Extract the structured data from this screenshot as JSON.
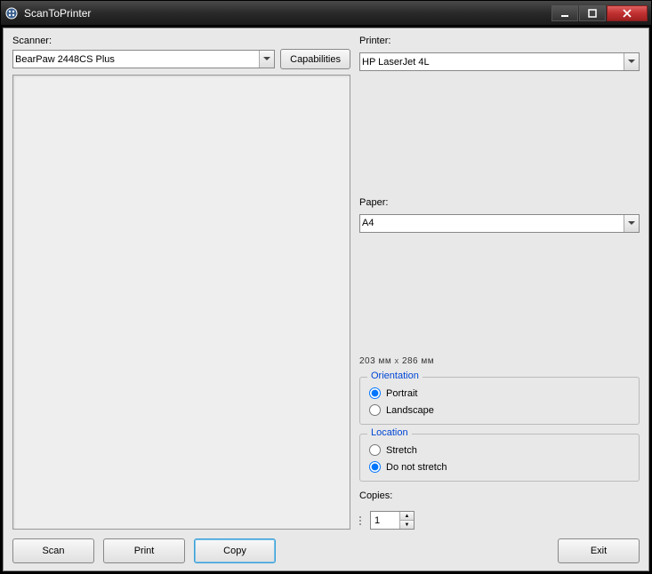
{
  "window": {
    "title": "ScanToPrinter"
  },
  "scanner": {
    "label": "Scanner:",
    "selected": "BearPaw 2448CS Plus",
    "capabilities_label": "Capabilities"
  },
  "printer": {
    "label": "Printer:",
    "selected": "HP LaserJet 4L"
  },
  "paper": {
    "label": "Paper:",
    "selected": "A4",
    "dimensions": "203 ᴍᴍ x 286 ᴍᴍ"
  },
  "orientation": {
    "group_label": "Orientation",
    "options": {
      "portrait": "Portrait",
      "landscape": "Landscape"
    },
    "selected": "portrait"
  },
  "location": {
    "group_label": "Location",
    "options": {
      "stretch": "Stretch",
      "nostretch": "Do not stretch"
    },
    "selected": "nostretch"
  },
  "copies": {
    "label": "Copies:",
    "value": "1"
  },
  "buttons": {
    "scan": "Scan",
    "print": "Print",
    "copy": "Copy",
    "exit": "Exit"
  }
}
